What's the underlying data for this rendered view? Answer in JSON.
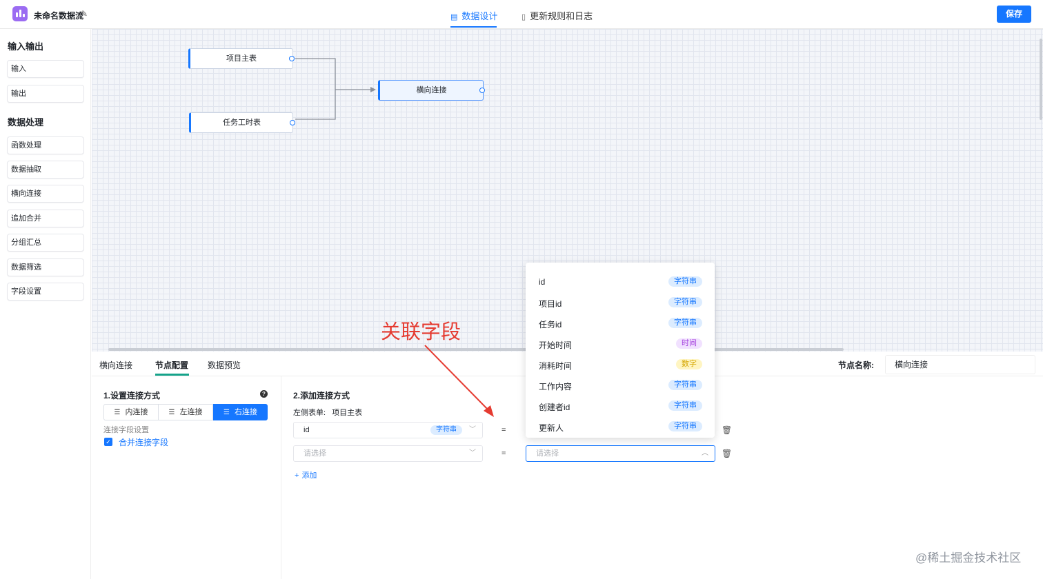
{
  "header": {
    "title": "未命名数据流",
    "tabs": [
      {
        "label": "数据设计",
        "active": true
      },
      {
        "label": "更新规则和日志",
        "active": false
      }
    ],
    "save_label": "保存"
  },
  "sidebar": {
    "groups": [
      {
        "title": "输入输出",
        "items": [
          "输入",
          "输出"
        ]
      },
      {
        "title": "数据处理",
        "items": [
          "函数处理",
          "数据抽取",
          "横向连接",
          "追加合并",
          "分组汇总",
          "数据筛选",
          "字段设置"
        ]
      }
    ]
  },
  "canvas": {
    "nodes": [
      {
        "label": "项目主表"
      },
      {
        "label": "任务工时表"
      },
      {
        "label": "横向连接",
        "selected": true
      }
    ]
  },
  "bottom": {
    "tabs": [
      "横向连接",
      "节点配置",
      "数据预览"
    ],
    "active_tab": "节点配置",
    "node_name_label": "节点名称:",
    "node_name_value": "横向连接",
    "join": {
      "title": "1.设置连接方式",
      "help_icon": "?",
      "options": [
        "内连接",
        "左连接",
        "右连接"
      ],
      "active_option": "右连接",
      "field_settings_label": "连接字段设置",
      "merge_checkbox_label": "合并连接字段",
      "merge_checked": true
    },
    "add_join": {
      "title": "2.添加连接方式",
      "left_table_label": "左侧表单:",
      "left_table_value": "项目主表",
      "rows": [
        {
          "left_value": "id",
          "left_type": "字符串",
          "operator": "="
        },
        {
          "left_placeholder": "请选择",
          "operator": "=",
          "right_placeholder": "请选择"
        }
      ],
      "add_label": "添加"
    }
  },
  "dropdown": {
    "items": [
      {
        "label": "id",
        "type": "字符串",
        "kind": "str"
      },
      {
        "label": "项目id",
        "type": "字符串",
        "kind": "str"
      },
      {
        "label": "任务id",
        "type": "字符串",
        "kind": "str"
      },
      {
        "label": "开始时间",
        "type": "时间",
        "kind": "time"
      },
      {
        "label": "消耗时间",
        "type": "数字",
        "kind": "num"
      },
      {
        "label": "工作内容",
        "type": "字符串",
        "kind": "str"
      },
      {
        "label": "创建者id",
        "type": "字符串",
        "kind": "str"
      },
      {
        "label": "更新人",
        "type": "字符串",
        "kind": "str"
      }
    ]
  },
  "annotation": "关联字段",
  "watermark": "@稀土掘金技术社区",
  "colors": {
    "accent": "#1677ff",
    "teal": "#15a38a",
    "annotation": "#e53b31",
    "logo": "#9b6cf2"
  }
}
